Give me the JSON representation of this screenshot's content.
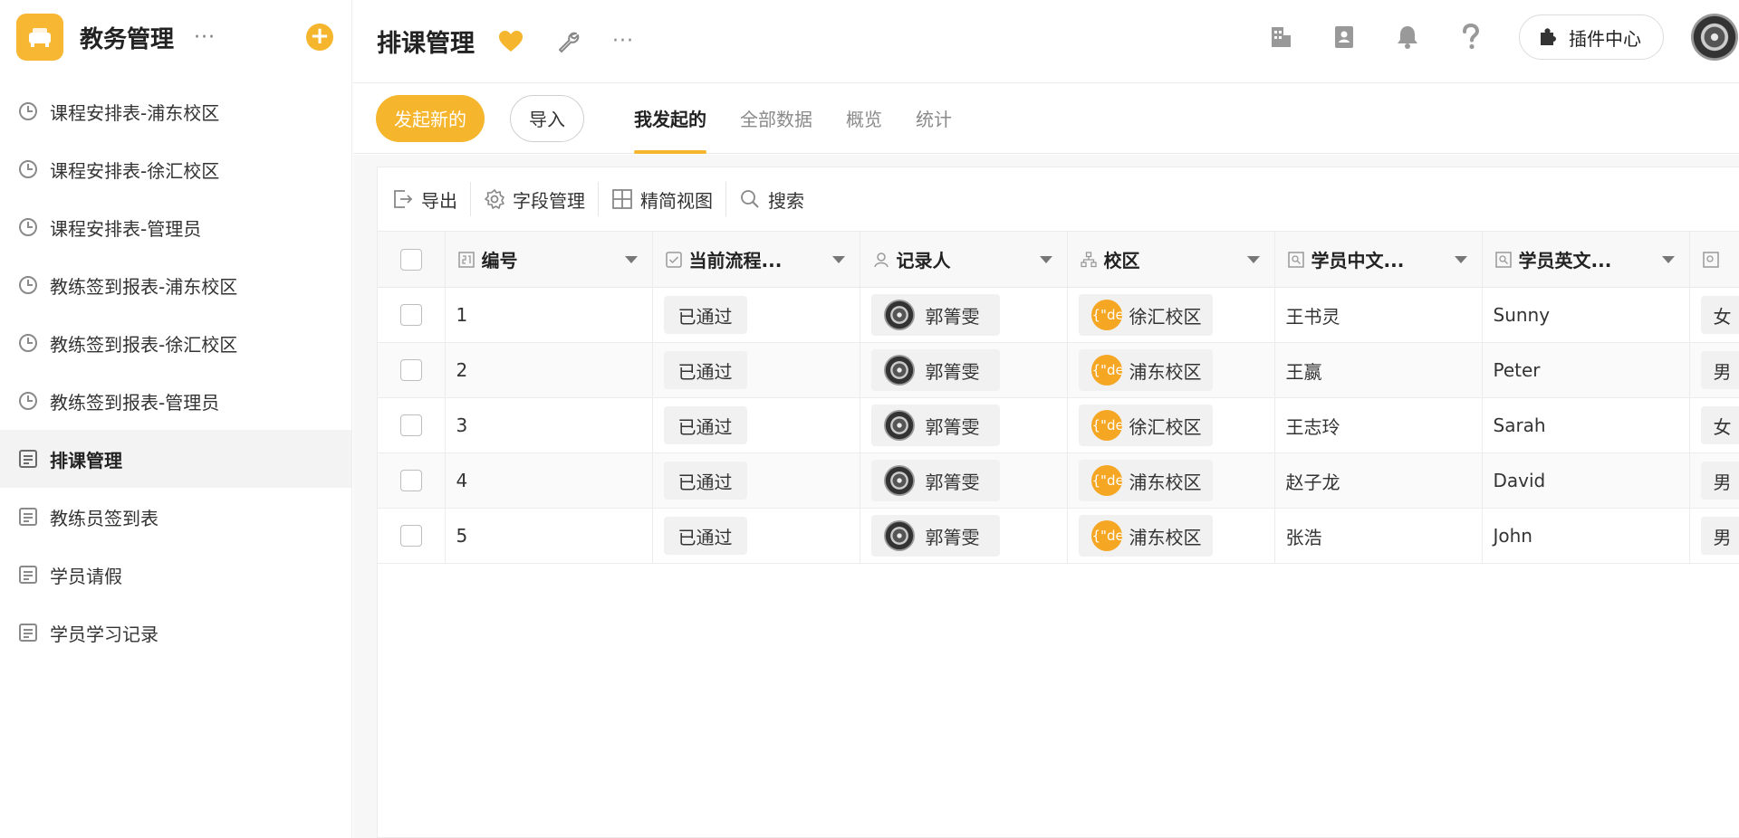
{
  "sidebar": {
    "app_title": "教务管理",
    "more": "···",
    "add": "+",
    "items": [
      {
        "label": "课程安排表-浦东校区",
        "icon": "clock-icon"
      },
      {
        "label": "课程安排表-徐汇校区",
        "icon": "clock-icon"
      },
      {
        "label": "课程安排表-管理员",
        "icon": "clock-icon"
      },
      {
        "label": "教练签到报表-浦东校区",
        "icon": "clock-icon"
      },
      {
        "label": "教练签到报表-徐汇校区",
        "icon": "clock-icon"
      },
      {
        "label": "教练签到报表-管理员",
        "icon": "clock-icon"
      },
      {
        "label": "排课管理",
        "icon": "form-icon",
        "active": true
      },
      {
        "label": "教练员签到表",
        "icon": "form-icon"
      },
      {
        "label": "学员请假",
        "icon": "form-icon"
      },
      {
        "label": "学员学习记录",
        "icon": "form-icon"
      }
    ]
  },
  "header": {
    "title": "排课管理",
    "more": "···",
    "plugin_center": "插件中心"
  },
  "actions": {
    "new": "发起新的",
    "import": "导入"
  },
  "tabs": [
    {
      "label": "我发起的",
      "active": true
    },
    {
      "label": "全部数据"
    },
    {
      "label": "概览"
    },
    {
      "label": "统计"
    }
  ],
  "toolbar": {
    "export": "导出",
    "fields": "字段管理",
    "compact_view": "精简视图",
    "search": "搜索"
  },
  "table": {
    "columns": [
      "编号",
      "当前流程...",
      "记录人",
      "校区",
      "学员中文...",
      "学员英文..."
    ],
    "rows": [
      {
        "id": "1",
        "status": "已通过",
        "recorder": "郭箐雯",
        "campus_prefix": "{\"de",
        "campus": "徐汇校区",
        "cn_name": "王书灵",
        "en_name": "Sunny",
        "gender": "女"
      },
      {
        "id": "2",
        "status": "已通过",
        "recorder": "郭箐雯",
        "campus_prefix": "{\"de",
        "campus": "浦东校区",
        "cn_name": "王嬴",
        "en_name": "Peter",
        "gender": "男"
      },
      {
        "id": "3",
        "status": "已通过",
        "recorder": "郭箐雯",
        "campus_prefix": "{\"de",
        "campus": "徐汇校区",
        "cn_name": "王志玲",
        "en_name": "Sarah",
        "gender": "女"
      },
      {
        "id": "4",
        "status": "已通过",
        "recorder": "郭箐雯",
        "campus_prefix": "{\"de",
        "campus": "浦东校区",
        "cn_name": "赵子龙",
        "en_name": "David",
        "gender": "男"
      },
      {
        "id": "5",
        "status": "已通过",
        "recorder": "郭箐雯",
        "campus_prefix": "{\"de",
        "campus": "浦东校区",
        "cn_name": "张浩",
        "en_name": "John",
        "gender": "男"
      }
    ]
  },
  "colors": {
    "accent": "#f5b52c",
    "campus_avatar": "#f5a623"
  }
}
